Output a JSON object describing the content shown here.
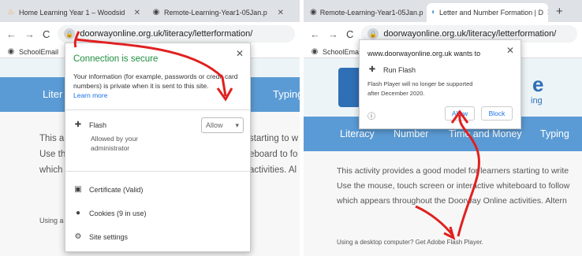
{
  "left": {
    "tabs": [
      {
        "label": "Home Learning Year 1 – Woodsid",
        "icon": "flame-icon"
      },
      {
        "label": "Remote-Learning-Year1-05Jan.p",
        "icon": "globe-icon"
      }
    ],
    "address": "doorwayonline.org.uk/literacy/letterformation/",
    "bookmark": "SchoolEmail",
    "nav": [
      "Liter",
      "Typing"
    ],
    "content_lines": [
      "This a",
      "Use th",
      "which"
    ],
    "content_right_lines": [
      "starting to w",
      "eboard to fo",
      "activities. Al"
    ],
    "using_text": "Using a",
    "popup": {
      "title": "Connection is secure",
      "body": "Your information (for example, passwords or credit card numbers) is private when it is sent to this site.",
      "learn_more": "Learn more",
      "flash_label": "Flash",
      "flash_sub": "Allowed by your administrator",
      "flash_select": "Allow",
      "certificate": "Certificate (Valid)",
      "cookies": "Cookies (9 in use)",
      "site_settings": "Site settings"
    }
  },
  "right": {
    "tabs": [
      {
        "label": "Remote-Learning-Year1-05Jan.p",
        "icon": "globe-icon"
      },
      {
        "label": "Letter and Number Formation | D",
        "icon": "doorway-icon"
      }
    ],
    "new_tab": "+",
    "address": "doorwayonline.org.uk/literacy/letterformation/",
    "bookmark": "SchoolEmail",
    "logo_text": "e",
    "logo_sub": "ing",
    "nav": [
      "Literacy",
      "Number",
      "Time and Money",
      "Typing"
    ],
    "content_lines": [
      "This activity provides a good model for learners starting to write",
      "Use the mouse, touch screen or interactive whiteboard to follow",
      "which appears throughout the Doorway Online activities. Altern"
    ],
    "desktop_text": "Using a desktop computer? Get Adobe Flash Player.",
    "popup": {
      "title": "www.doorwayonline.org.uk wants to",
      "item": "Run Flash",
      "note": "Flash Player will no longer be supported after December 2020.",
      "allow": "Allow",
      "block": "Block"
    }
  },
  "colors": {
    "arrow": "#e02020",
    "nav": "#5b9bd5",
    "link": "#1a73e8"
  }
}
